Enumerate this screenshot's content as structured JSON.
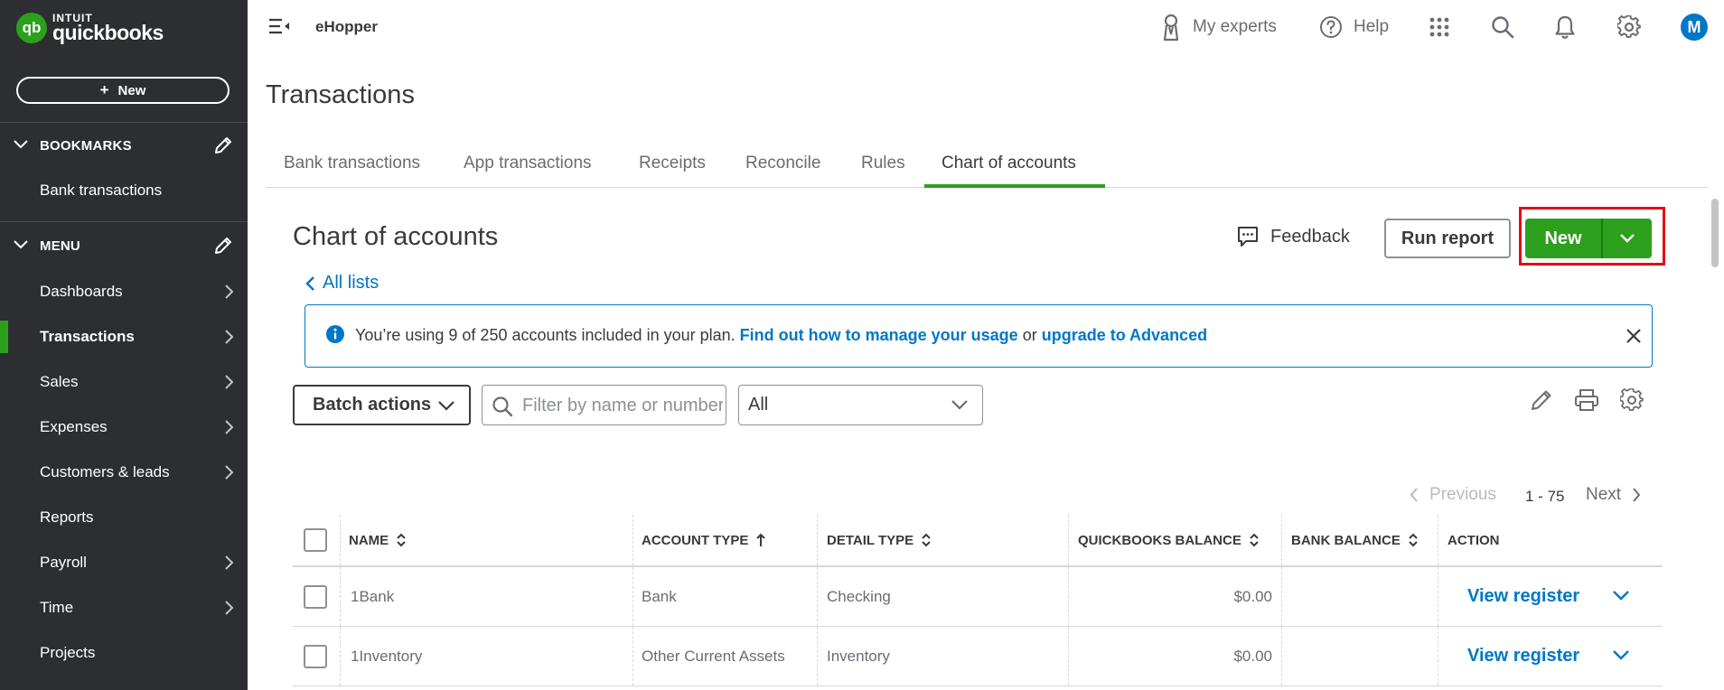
{
  "sidebar": {
    "logo_mark": "qb",
    "logo_intuit": "INTUIT",
    "logo_product": "quickbooks",
    "new_button": "New",
    "bookmarks_label": "BOOKMARKS",
    "bookmarks": [
      {
        "label": "Bank transactions"
      }
    ],
    "menu_label": "MENU",
    "menu_items": [
      {
        "label": "Dashboards",
        "has_chevron": true
      },
      {
        "label": "Transactions",
        "has_chevron": true,
        "active": true
      },
      {
        "label": "Sales",
        "has_chevron": true
      },
      {
        "label": "Expenses",
        "has_chevron": true
      },
      {
        "label": "Customers & leads",
        "has_chevron": true
      },
      {
        "label": "Reports",
        "has_chevron": false
      },
      {
        "label": "Payroll",
        "has_chevron": true
      },
      {
        "label": "Time",
        "has_chevron": true
      },
      {
        "label": "Projects",
        "has_chevron": false
      }
    ]
  },
  "header": {
    "company": "eHopper",
    "my_experts": "My experts",
    "help": "Help",
    "avatar_initial": "M",
    "icons": [
      "menu-collapse-icon",
      "experts-icon",
      "help-icon",
      "apps-grid-icon",
      "search-icon",
      "bell-icon",
      "gear-icon"
    ]
  },
  "page": {
    "title": "Transactions",
    "tabs": [
      {
        "label": "Bank transactions"
      },
      {
        "label": "App transactions"
      },
      {
        "label": "Receipts"
      },
      {
        "label": "Reconcile"
      },
      {
        "label": "Rules"
      },
      {
        "label": "Chart of accounts",
        "active": true
      }
    ]
  },
  "content": {
    "title": "Chart of accounts",
    "feedback": "Feedback",
    "run_report": "Run report",
    "new_button": "New",
    "all_lists": "All lists",
    "banner": {
      "text": "You’re using 9 of 250 accounts included in your plan.",
      "link1": "Find out how to manage your usage",
      "middle": "or",
      "link2": "upgrade to Advanced"
    },
    "batch_actions": "Batch actions",
    "search_placeholder": "Filter by name or number",
    "filter_value": "All",
    "pager": {
      "previous": "Previous",
      "range": "1 - 75",
      "next": "Next"
    }
  },
  "table": {
    "headers": {
      "name": "NAME",
      "account_type": "ACCOUNT TYPE",
      "detail_type": "DETAIL TYPE",
      "qb_balance": "QUICKBOOKS BALANCE",
      "bank_balance": "BANK BALANCE",
      "action": "ACTION"
    },
    "rows": [
      {
        "name": "1Bank",
        "account_type": "Bank",
        "detail_type": "Checking",
        "qb_balance": "$0.00",
        "bank_balance": "",
        "action": "View register"
      },
      {
        "name": "1Inventory",
        "account_type": "Other Current Assets",
        "detail_type": "Inventory",
        "qb_balance": "$0.00",
        "bank_balance": "",
        "action": "View register"
      }
    ]
  },
  "colors": {
    "brand_green": "#2ca01c",
    "link_blue": "#0077c5",
    "sidebar_bg": "#2d2e31",
    "highlight_red": "#e50914"
  }
}
